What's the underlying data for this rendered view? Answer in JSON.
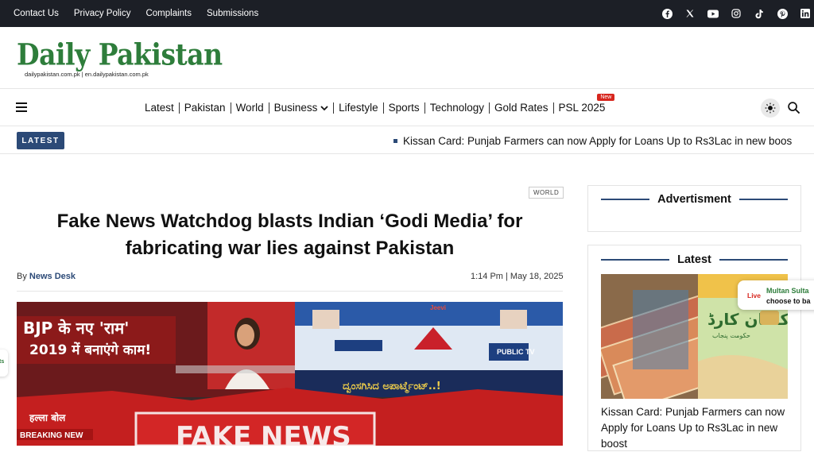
{
  "topbar": {
    "links": [
      "Contact Us",
      "Privacy Policy",
      "Complaints",
      "Submissions"
    ],
    "social_icons": [
      "facebook-icon",
      "x-icon",
      "youtube-icon",
      "instagram-icon",
      "tiktok-icon",
      "pinterest-icon",
      "linkedin-icon"
    ]
  },
  "header": {
    "logo_text": "Daily Pakistan",
    "domains": "dailypakistan.com.pk  |  en.dailypakistan.com.pk"
  },
  "nav": {
    "items": [
      "Latest",
      "Pakistan",
      "World",
      "Business",
      "Lifestyle",
      "Sports",
      "Technology",
      "Gold Rates",
      "PSL 2025"
    ],
    "new_badge": "New"
  },
  "ticker": {
    "label": "LATEST",
    "text": "Kissan Card: Punjab Farmers can now Apply for Loans Up to Rs3Lac in new boos"
  },
  "article": {
    "category": "WORLD",
    "headline": "Fake News Watchdog blasts Indian ‘Godi Media’ for fabricating war lies against Pakistan",
    "by": "By",
    "author": "News Desk",
    "date": "1:14 Pm | May 18, 2025",
    "hero_texts": {
      "left_banner_1": "BJP के नए 'राम'",
      "left_banner_2": "2019 में बनाएंगे काम!",
      "hallabol": "हल्ला बोल",
      "breaking": "BREAKING NEW",
      "fakenews": "FAKE NEWS",
      "channel": "PUBLIC TV",
      "kannada": "ದ್ವಂಸಗಿಸಿದ ಅಪಾರ್ಟ್ಮೆಂಟ್..!",
      "jeevi": "Jeevi"
    }
  },
  "sidebar": {
    "ad_title": "Advertisment",
    "latest_title": "Latest",
    "story_title": "Kissan Card: Punjab Farmers can now Apply for Loans Up to Rs3Lac in new boost",
    "card_urdu": "کسان کارڈ",
    "card_sub": "حکومت پنجاب"
  },
  "live_popup": {
    "badge": "Live",
    "text_1": "Multan Sulta",
    "text_2": "choose to ba"
  },
  "left_popup": {
    "text": "ts"
  },
  "colors": {
    "brand_green": "#2e7d3b",
    "accent_blue": "#2c4a77",
    "topbar": "#1c1f26",
    "live_red": "#d7261e"
  }
}
